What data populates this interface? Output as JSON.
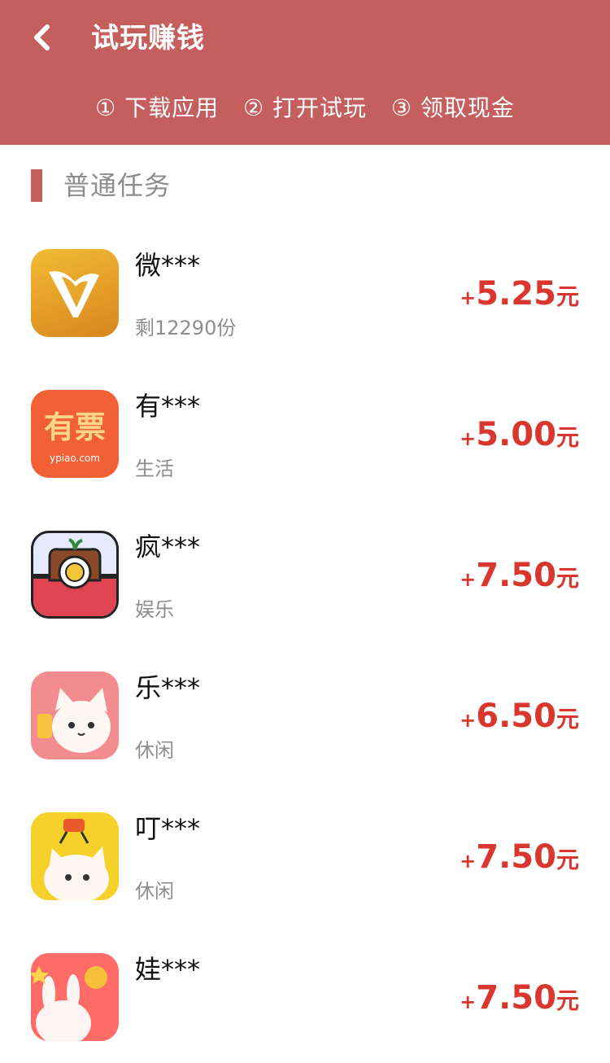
{
  "header": {
    "title": "试玩赚钱",
    "steps": [
      "① 下载应用",
      "② 打开试玩",
      "③ 领取现金"
    ]
  },
  "section": {
    "title": "普通任务"
  },
  "items": [
    {
      "name": "微***",
      "sub": "剩12290份",
      "plus": "+",
      "amount": "5.25",
      "unit": "元",
      "icon": "wei-app-icon"
    },
    {
      "name": "有***",
      "sub": "生活",
      "plus": "+",
      "amount": "5.00",
      "unit": "元",
      "icon": "youpiao-app-icon",
      "icon_text": "有票",
      "icon_url": "ypiao.com"
    },
    {
      "name": "疯***",
      "sub": "娱乐",
      "plus": "+",
      "amount": "7.50",
      "unit": "元",
      "icon": "camera-app-icon"
    },
    {
      "name": "乐***",
      "sub": "休闲",
      "plus": "+",
      "amount": "6.50",
      "unit": "元",
      "icon": "cat-app-icon"
    },
    {
      "name": "叮***",
      "sub": "休闲",
      "plus": "+",
      "amount": "7.50",
      "unit": "元",
      "icon": "cat-yellow-app-icon"
    },
    {
      "name": "娃***",
      "sub": "",
      "plus": "+",
      "amount": "7.50",
      "unit": "元",
      "icon": "bunny-app-icon"
    }
  ],
  "colors": {
    "header_bg": "#c45f5e",
    "reward": "#d9372e",
    "section_bar": "#c45f5e"
  }
}
